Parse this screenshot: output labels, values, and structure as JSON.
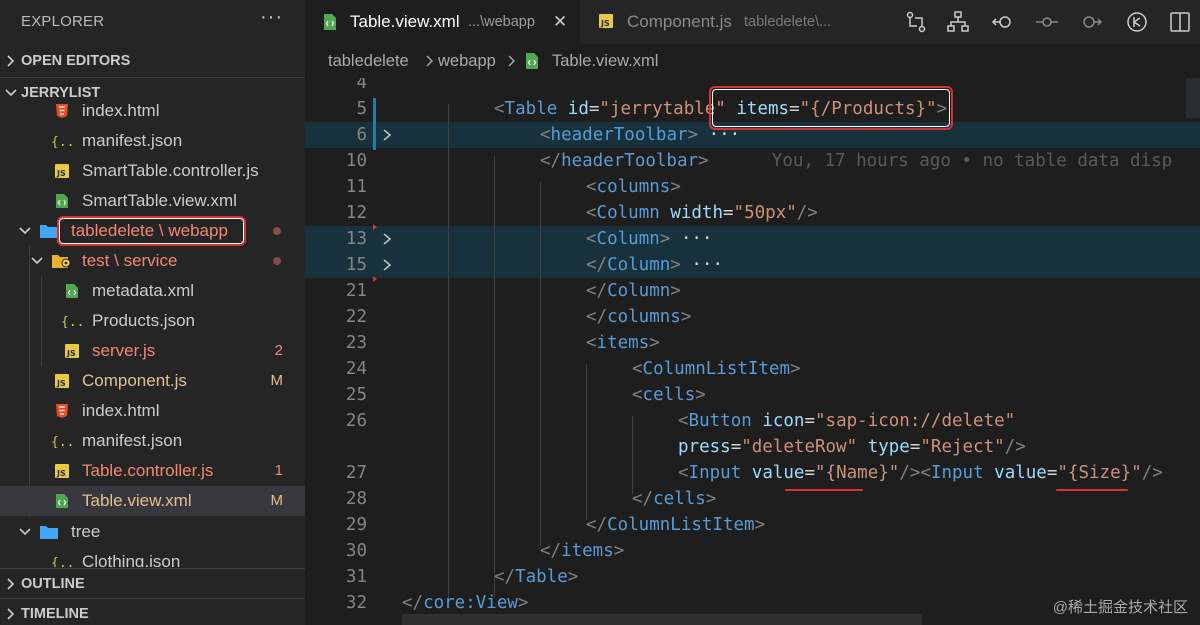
{
  "sidebar": {
    "title": "EXPLORER",
    "more": "···",
    "sections": {
      "open_editors": "OPEN EDITORS",
      "project": "JERRYLIST",
      "outline": "OUTLINE",
      "timeline": "TIMELINE"
    },
    "files": [
      {
        "label": "index.html",
        "icon": "html-icon"
      },
      {
        "label": "manifest.json",
        "icon": "json-icon"
      },
      {
        "label": "SmartTable.controller.js",
        "icon": "js-icon"
      },
      {
        "label": "SmartTable.view.xml",
        "icon": "xml-icon"
      },
      {
        "label": "tabledelete \\ webapp",
        "icon": "folder-icon"
      },
      {
        "label": "test \\ service",
        "icon": "folder-gear-icon"
      },
      {
        "label": "metadata.xml",
        "icon": "xml-icon"
      },
      {
        "label": "Products.json",
        "icon": "json-icon"
      },
      {
        "label": "server.js",
        "icon": "js-icon",
        "status": "2"
      },
      {
        "label": "Component.js",
        "icon": "js-icon",
        "status": "M"
      },
      {
        "label": "index.html",
        "icon": "html-icon"
      },
      {
        "label": "manifest.json",
        "icon": "json-icon"
      },
      {
        "label": "Table.controller.js",
        "icon": "js-icon",
        "status": "1"
      },
      {
        "label": "Table.view.xml",
        "icon": "xml-icon",
        "status": "M"
      },
      {
        "label": "tree",
        "icon": "folder-icon"
      },
      {
        "label": "Clothing.json",
        "icon": "json-icon"
      }
    ]
  },
  "tabs": [
    {
      "name": "Table.view.xml",
      "desc": "...\\webapp",
      "close": "✕"
    },
    {
      "name": "Component.js",
      "desc": "tabledelete\\..."
    }
  ],
  "breadcrumb": [
    "tabledelete",
    "webapp",
    "Table.view.xml"
  ],
  "editor": {
    "lines": [
      {
        "n": "4",
        "tokens": []
      },
      {
        "n": "5",
        "tokens": [
          [
            "p",
            "<"
          ],
          [
            "t",
            "Table"
          ],
          [
            "w",
            " "
          ],
          [
            "a",
            "id"
          ],
          [
            "w",
            "="
          ],
          [
            "s",
            "\"jerrytable\""
          ],
          [
            "w",
            " "
          ],
          [
            "a",
            "items"
          ],
          [
            "w",
            "="
          ],
          [
            "s",
            "\"{/Products}\""
          ],
          [
            "p",
            ">"
          ]
        ]
      },
      {
        "n": "6",
        "tokens": [
          [
            "p",
            "<"
          ],
          [
            "t",
            "headerToolbar"
          ],
          [
            "p",
            ">"
          ],
          [
            "w",
            " ···"
          ]
        ]
      },
      {
        "n": "10",
        "tokens": [
          [
            "p",
            "</"
          ],
          [
            "t",
            "headerToolbar"
          ],
          [
            "p",
            ">"
          ],
          [
            "blame",
            "      You, 17 hours ago • no table data disp"
          ]
        ]
      },
      {
        "n": "11",
        "tokens": [
          [
            "p",
            "<"
          ],
          [
            "t",
            "columns"
          ],
          [
            "p",
            ">"
          ]
        ]
      },
      {
        "n": "12",
        "tokens": [
          [
            "p",
            "<"
          ],
          [
            "t",
            "Column"
          ],
          [
            "w",
            " "
          ],
          [
            "a",
            "width"
          ],
          [
            "w",
            "="
          ],
          [
            "s",
            "\"50px\""
          ],
          [
            "p",
            "/>"
          ]
        ]
      },
      {
        "n": "13",
        "tokens": [
          [
            "p",
            "<"
          ],
          [
            "t",
            "Column"
          ],
          [
            "p",
            ">"
          ],
          [
            "w",
            " ···"
          ]
        ]
      },
      {
        "n": "15",
        "tokens": [
          [
            "p",
            "</"
          ],
          [
            "t",
            "Column"
          ],
          [
            "p",
            ">"
          ],
          [
            "w",
            " ···"
          ]
        ]
      },
      {
        "n": "21",
        "tokens": [
          [
            "p",
            "</"
          ],
          [
            "t",
            "Column"
          ],
          [
            "p",
            ">"
          ]
        ]
      },
      {
        "n": "22",
        "tokens": [
          [
            "p",
            "</"
          ],
          [
            "t",
            "columns"
          ],
          [
            "p",
            ">"
          ]
        ]
      },
      {
        "n": "23",
        "tokens": [
          [
            "p",
            "<"
          ],
          [
            "t",
            "items"
          ],
          [
            "p",
            ">"
          ]
        ]
      },
      {
        "n": "24",
        "tokens": [
          [
            "p",
            "<"
          ],
          [
            "t",
            "ColumnListItem"
          ],
          [
            "p",
            ">"
          ]
        ]
      },
      {
        "n": "25",
        "tokens": [
          [
            "p",
            "<"
          ],
          [
            "t",
            "cells"
          ],
          [
            "p",
            ">"
          ]
        ]
      },
      {
        "n": "26",
        "tokens": [
          [
            "p",
            "<"
          ],
          [
            "t",
            "Button"
          ],
          [
            "w",
            " "
          ],
          [
            "a",
            "icon"
          ],
          [
            "w",
            "="
          ],
          [
            "s",
            "\"sap-icon://delete\""
          ]
        ]
      },
      {
        "n": "",
        "tokens": [
          [
            "a",
            "press"
          ],
          [
            "w",
            "="
          ],
          [
            "s",
            "\"deleteRow\""
          ],
          [
            "w",
            " "
          ],
          [
            "a",
            "type"
          ],
          [
            "w",
            "="
          ],
          [
            "s",
            "\"Reject\""
          ],
          [
            "p",
            "/>"
          ]
        ]
      },
      {
        "n": "27",
        "tokens": [
          [
            "p",
            "<"
          ],
          [
            "t",
            "Input"
          ],
          [
            "w",
            " "
          ],
          [
            "a",
            "value"
          ],
          [
            "w",
            "="
          ],
          [
            "s",
            "\"{Name}\""
          ],
          [
            "p",
            "/><"
          ],
          [
            "t",
            "Input"
          ],
          [
            "w",
            " "
          ],
          [
            "a",
            "value"
          ],
          [
            "w",
            "="
          ],
          [
            "s",
            "\"{Size}\""
          ],
          [
            "p",
            "/>"
          ]
        ]
      },
      {
        "n": "28",
        "tokens": [
          [
            "p",
            "</"
          ],
          [
            "t",
            "cells"
          ],
          [
            "p",
            ">"
          ]
        ]
      },
      {
        "n": "29",
        "tokens": [
          [
            "p",
            "</"
          ],
          [
            "t",
            "ColumnListItem"
          ],
          [
            "p",
            ">"
          ]
        ]
      },
      {
        "n": "30",
        "tokens": [
          [
            "p",
            "</"
          ],
          [
            "t",
            "items"
          ],
          [
            "p",
            ">"
          ]
        ]
      },
      {
        "n": "31",
        "tokens": [
          [
            "p",
            "</"
          ],
          [
            "t",
            "Table"
          ],
          [
            "p",
            ">"
          ]
        ]
      },
      {
        "n": "32",
        "tokens": [
          [
            "p",
            "</"
          ],
          [
            "t",
            "core:View"
          ],
          [
            "p",
            ">"
          ]
        ]
      }
    ]
  },
  "watermark": "@稀土掘金技术社区",
  "colors": {
    "tag": "#569cd6",
    "attr": "#9cdcfe",
    "string": "#ce9178",
    "modified": "#e2c08d",
    "error": "#f48771",
    "highlight": "#d93030"
  }
}
